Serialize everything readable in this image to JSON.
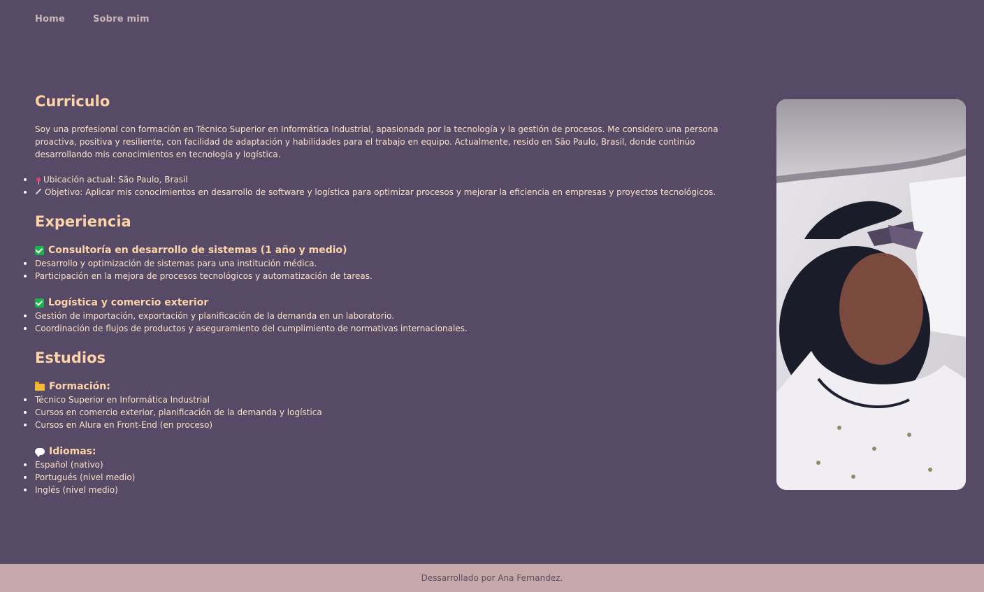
{
  "nav": {
    "items": [
      "Home",
      "Sobre mim"
    ]
  },
  "curriculo": {
    "title": "Curriculo",
    "intro": "Soy una profesional con formación en Técnico Superior en Informática Industrial, apasionada por la tecnología y la gestión de procesos. Me considero una persona proactiva, positiva y resiliente, con facilidad de adaptación y habilidades para el trabajo en equipo. Actualmente, resido en São Paulo, Brasil, donde continúo desarrollando mis conocimientos en tecnología y logística.",
    "location": "Ubicación actual: São Paulo, Brasil",
    "objective": "Objetivo: Aplicar mis conocimientos en desarrollo de software y logística para optimizar procesos y mejorar la eficiencia en empresas y proyectos tecnológicos."
  },
  "experiencia": {
    "title": "Experiencia",
    "jobs": [
      {
        "title": "Consultoría en desarrollo de sistemas (1 año y medio)",
        "items": [
          "Desarrollo y optimización de sistemas para una institución médica.",
          "Participación en la mejora de procesos tecnológicos y automatización de tareas."
        ]
      },
      {
        "title": "Logística y comercio exterior",
        "items": [
          "Gestión de importación, exportación y planificación de la demanda en un laboratorio.",
          "Coordinación de flujos de productos y aseguramiento del cumplimiento de normativas internacionales."
        ]
      }
    ]
  },
  "estudios": {
    "title": "Estudios",
    "formacion": {
      "title": "Formación:",
      "items": [
        "Técnico Superior en Informática Industrial",
        "Cursos en comercio exterior, planificación de la demanda y logística",
        "Cursos en Alura en Front-End (en proceso)"
      ]
    },
    "idiomas": {
      "title": "Idiomas:",
      "items": [
        "Español (nativo)",
        "Portugués (nivel medio)",
        "Inglés (nivel medio)"
      ]
    }
  },
  "footer": {
    "text": "Dessarrollado por Ana Fernandez."
  },
  "colors": {
    "background": "#564a66",
    "heading": "#fdd3a8",
    "text": "#fbe3c8",
    "footer_bg": "#c6a8aa"
  }
}
